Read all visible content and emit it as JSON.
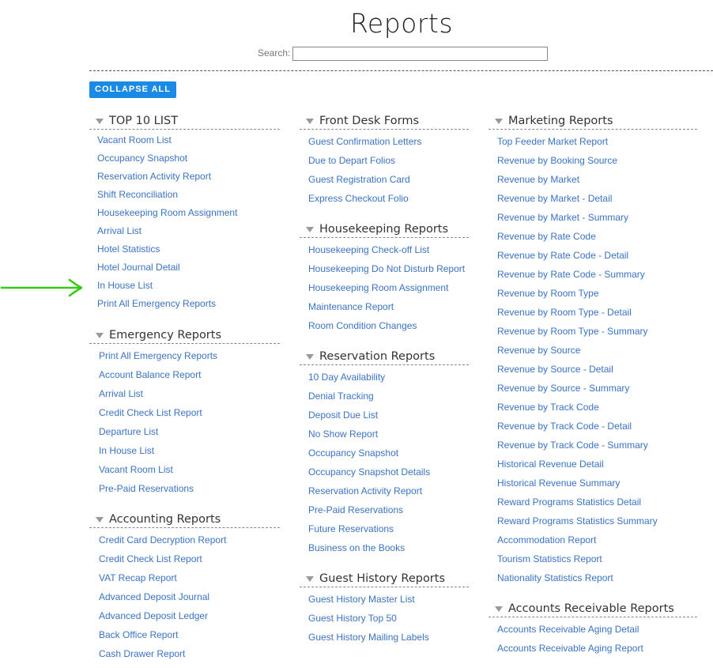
{
  "page": {
    "title": "Reports"
  },
  "search": {
    "label": "Search:",
    "value": ""
  },
  "toolbar": {
    "collapse_all": "COLLAPSE ALL"
  },
  "colors": {
    "accent": "#1a8ae6",
    "link": "#3a73c4",
    "arrow": "#33cc11"
  },
  "columns": [
    [
      {
        "title": "TOP 10 LIST",
        "items": [
          "Vacant Room List",
          "Occupancy Snapshot",
          "Reservation Activity Report",
          "Shift Reconciliation",
          "Housekeeping Room Assignment",
          "Arrival List",
          "Hotel Statistics",
          "Hotel Journal Detail",
          "In House List",
          "Print All Emergency Reports"
        ]
      },
      {
        "title": "Emergency Reports",
        "items": [
          "Print All Emergency Reports",
          "Account Balance Report",
          "Arrival List",
          "Credit Check List Report",
          "Departure List",
          "In House List",
          "Vacant Room List",
          "Pre-Paid Reservations"
        ]
      },
      {
        "title": "Accounting Reports",
        "items": [
          "Credit Card Decryption Report",
          "Credit Check List Report",
          "VAT Recap Report",
          "Advanced Deposit Journal",
          "Advanced Deposit Ledger",
          "Back Office Report",
          "Cash Drawer Report"
        ]
      }
    ],
    [
      {
        "title": "Front Desk Forms",
        "items": [
          "Guest Confirmation Letters",
          "Due to Depart Folios",
          "Guest Registration Card",
          "Express Checkout Folio"
        ]
      },
      {
        "title": "Housekeeping Reports",
        "items": [
          "Housekeeping Check-off List",
          "Housekeeping Do Not Disturb Report",
          "Housekeeping Room Assignment",
          "Maintenance Report",
          "Room Condition Changes"
        ]
      },
      {
        "title": "Reservation Reports",
        "items": [
          "10 Day Availability",
          "Denial Tracking",
          "Deposit Due List",
          "No Show Report",
          "Occupancy Snapshot",
          "Occupancy Snapshot Details",
          "Reservation Activity Report",
          "Pre-Paid Reservations",
          "Future Reservations",
          "Business on the Books"
        ]
      },
      {
        "title": "Guest History Reports",
        "items": [
          "Guest History Master List",
          "Guest History Top 50",
          "Guest History Mailing Labels"
        ]
      }
    ],
    [
      {
        "title": "Marketing Reports",
        "items": [
          "Top Feeder Market Report",
          "Revenue by Booking Source",
          "Revenue by Market",
          "Revenue by Market - Detail",
          "Revenue by Market - Summary",
          "Revenue by Rate Code",
          "Revenue by Rate Code - Detail",
          "Revenue by Rate Code - Summary",
          "Revenue by Room Type",
          "Revenue by Room Type - Detail",
          "Revenue by Room Type - Summary",
          "Revenue by Source",
          "Revenue by Source - Detail",
          "Revenue by Source - Summary",
          "Revenue by Track Code",
          "Revenue by Track Code - Detail",
          "Revenue by Track Code - Summary",
          "Historical Revenue Detail",
          "Historical Revenue Summary",
          "Reward Programs Statistics Detail",
          "Reward Programs Statistics Summary",
          "Accommodation Report",
          "Tourism Statistics Report",
          "Nationality Statistics Report"
        ]
      },
      {
        "title": "Accounts Receivable Reports",
        "items": [
          "Accounts Receivable Aging Detail",
          "Accounts Receivable Aging Report"
        ]
      }
    ]
  ]
}
